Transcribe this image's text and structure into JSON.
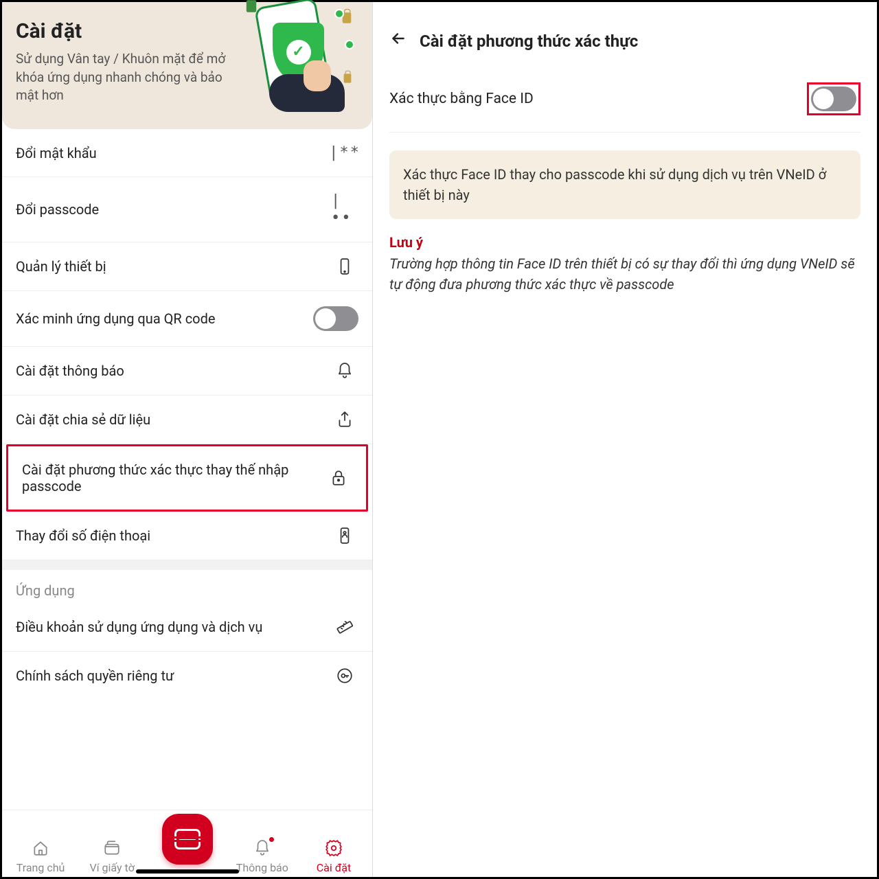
{
  "left": {
    "header": {
      "title": "Cài đặt",
      "subtitle": "Sử dụng Vân tay / Khuôn mặt để mở khóa ứng dụng nhanh chóng và bảo mật hơn"
    },
    "rows": {
      "change_password": "Đổi mật khẩu",
      "change_password_trail": "|**",
      "change_passcode": "Đổi passcode",
      "change_passcode_trail": "|••",
      "manage_devices": "Quản lý thiết bị",
      "verify_qr": "Xác minh ứng dụng qua QR code",
      "notif_settings": "Cài đặt thông báo",
      "share_data": "Cài đặt chia sẻ dữ liệu",
      "auth_method": "Cài đặt phương thức xác thực thay thế nhập passcode",
      "change_phone": "Thay đổi số điện thoại"
    },
    "section_app": "Ứng dụng",
    "app_rows": {
      "terms": "Điều khoản sử dụng ứng dụng và dịch vụ",
      "privacy": "Chính sách quyền riêng tư"
    },
    "nav": {
      "home": "Trang chủ",
      "wallet": "Ví giấy tờ",
      "notif": "Thông báo",
      "settings": "Cài đặt"
    }
  },
  "right": {
    "title": "Cài đặt phương thức xác thực",
    "faceid_label": "Xác thực bằng Face ID",
    "info": "Xác thực Face ID thay cho passcode khi sử dụng dịch vụ trên VNeID ở thiết bị này",
    "warn_title": "Lưu ý",
    "warn_body": "Trường hợp thông tin Face ID trên thiết bị có sự thay đổi thì ứng dụng VNeID sẽ tự động đưa phương thức xác thực về passcode"
  }
}
